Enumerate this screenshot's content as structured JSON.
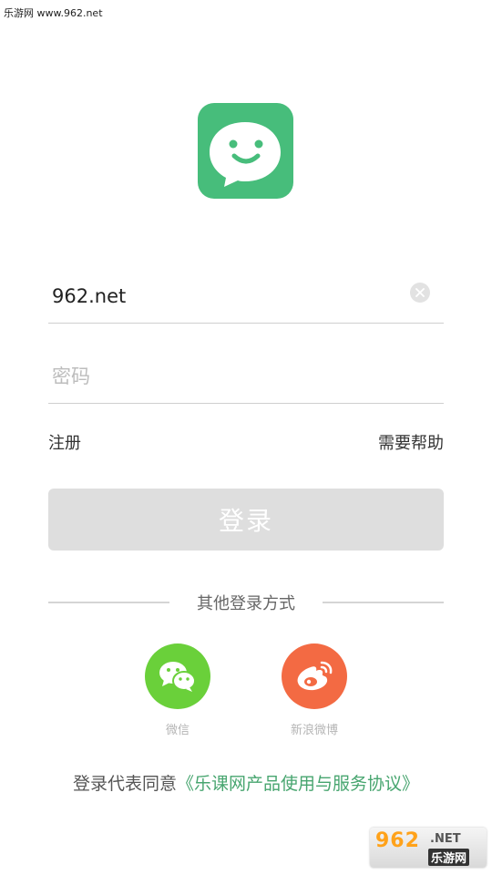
{
  "watermark": {
    "top_text": "乐游网 www.962.net",
    "bottom_digits": "962",
    "bottom_net": ".NET",
    "bottom_cn": "乐游网"
  },
  "login": {
    "username_value": "962.net",
    "password_placeholder": "密码",
    "register_label": "注册",
    "help_label": "需要帮助",
    "login_button_label": "登录"
  },
  "other_login": {
    "title": "其他登录方式",
    "options": [
      {
        "label": "微信",
        "icon": "wechat-icon",
        "color": "#6ad03a"
      },
      {
        "label": "新浪微博",
        "icon": "weibo-icon",
        "color": "#f36a43"
      }
    ]
  },
  "agreement": {
    "prefix": "登录代表同意",
    "link_text": "《乐课网产品使用与服务协议》"
  },
  "colors": {
    "brand_green": "#47bd7b",
    "button_disabled": "#dedede",
    "link_green": "#47a56f"
  }
}
